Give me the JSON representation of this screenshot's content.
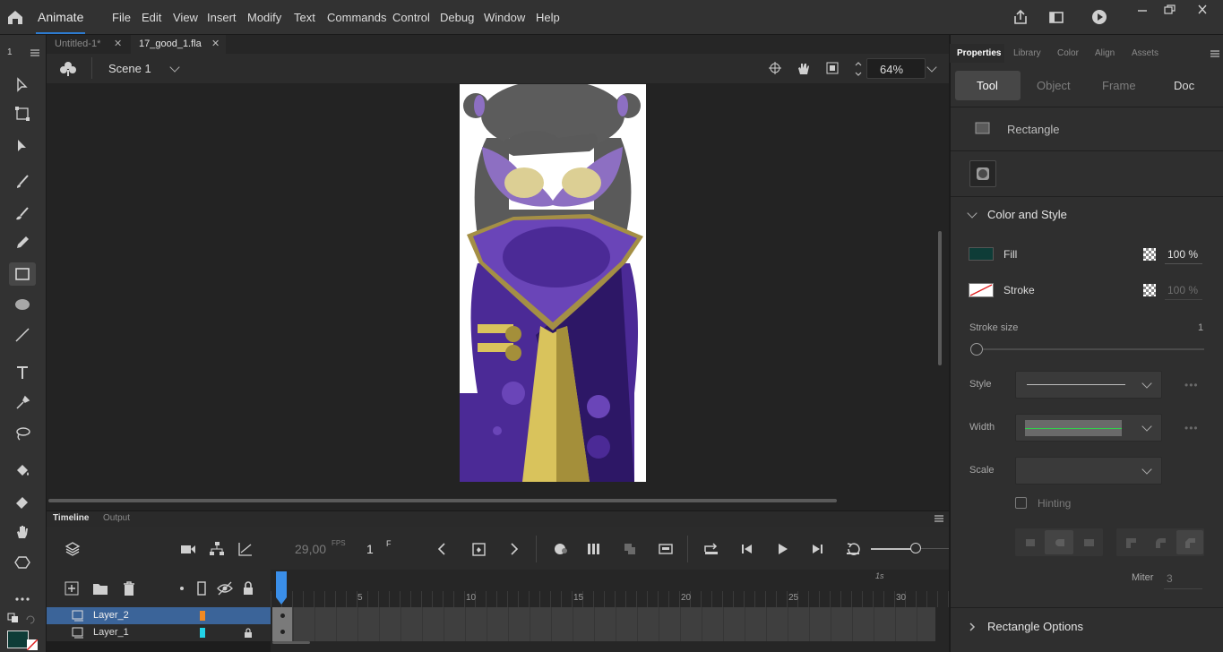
{
  "app": {
    "name": "Animate"
  },
  "menu": [
    "File",
    "Edit",
    "View",
    "Insert",
    "Modify",
    "Text",
    "Commands",
    "Control",
    "Debug",
    "Window",
    "Help"
  ],
  "doc_tabs": [
    {
      "label": "Untitled-1*",
      "active": false
    },
    {
      "label": "17_good_1.fla",
      "active": true
    }
  ],
  "left_strip_label": "1",
  "scene": {
    "label": "Scene 1",
    "zoom": "64%"
  },
  "timeline": {
    "tabs": [
      "Timeline",
      "Output"
    ],
    "fps": "29,00",
    "fps_unit": "FPS",
    "frame": "1",
    "frame_unit": "F",
    "ruler_ticks": [
      "5",
      "10",
      "15",
      "20",
      "25",
      "30"
    ],
    "second_marker": "1s",
    "layers": [
      {
        "name": "Layer_2",
        "color": "#f08a24",
        "selected": true
      },
      {
        "name": "Layer_1",
        "color": "#22d3e8",
        "selected": false
      }
    ]
  },
  "properties": {
    "panel_tabs": [
      "Properties",
      "Library",
      "Color",
      "Align",
      "Assets"
    ],
    "sub_tabs": [
      "Tool",
      "Object",
      "Frame",
      "Doc"
    ],
    "tool_name": "Rectangle",
    "section_color": "Color and Style",
    "fill_label": "Fill",
    "fill_color": "#0e3c37",
    "fill_alpha": "100 %",
    "stroke_label": "Stroke",
    "stroke_alpha": "100 %",
    "stroke_size_label": "Stroke size",
    "stroke_size_value": "1",
    "style_label": "Style",
    "width_label": "Width",
    "scale_label": "Scale",
    "hinting_label": "Hinting",
    "miter_label": "Miter",
    "miter_value": "3",
    "section_rect": "Rectangle Options"
  }
}
